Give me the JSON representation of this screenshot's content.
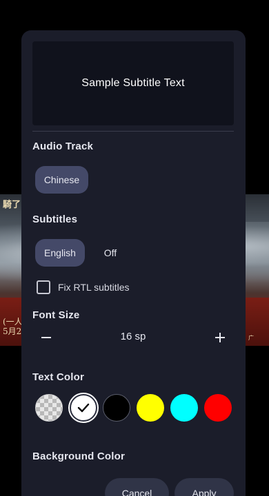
{
  "background": {
    "poster_text_top": "騎了",
    "poster_text_bottom": "(一人\n5月2",
    "poster_text_right": "广"
  },
  "dialog": {
    "preview_text": "Sample Subtitle Text",
    "audio_track": {
      "title": "Audio Track",
      "options": [
        {
          "label": "Chinese",
          "selected": true
        }
      ]
    },
    "subtitles": {
      "title": "Subtitles",
      "options": [
        {
          "label": "English",
          "selected": true
        },
        {
          "label": "Off",
          "selected": false
        }
      ],
      "fix_rtl_label": "Fix RTL subtitles",
      "fix_rtl_checked": false
    },
    "font_size": {
      "title": "Font Size",
      "value": "16 sp",
      "decrease_icon": "minus-icon",
      "increase_icon": "plus-icon"
    },
    "text_color": {
      "title": "Text Color",
      "swatches": [
        {
          "name": "transparent",
          "color": "transparent",
          "selected": false
        },
        {
          "name": "white",
          "color": "#ffffff",
          "selected": true
        },
        {
          "name": "black",
          "color": "#000000",
          "selected": false
        },
        {
          "name": "yellow",
          "color": "#ffff00",
          "selected": false
        },
        {
          "name": "cyan",
          "color": "#00ffff",
          "selected": false
        },
        {
          "name": "red",
          "color": "#ff0000",
          "selected": false
        }
      ]
    },
    "background_color": {
      "title": "Background Color"
    },
    "buttons": {
      "cancel": "Cancel",
      "apply": "Apply"
    }
  },
  "colors": {
    "dialog_bg": "#1b1d2a",
    "chip_selected": "#444968",
    "button_bg": "#303447"
  }
}
